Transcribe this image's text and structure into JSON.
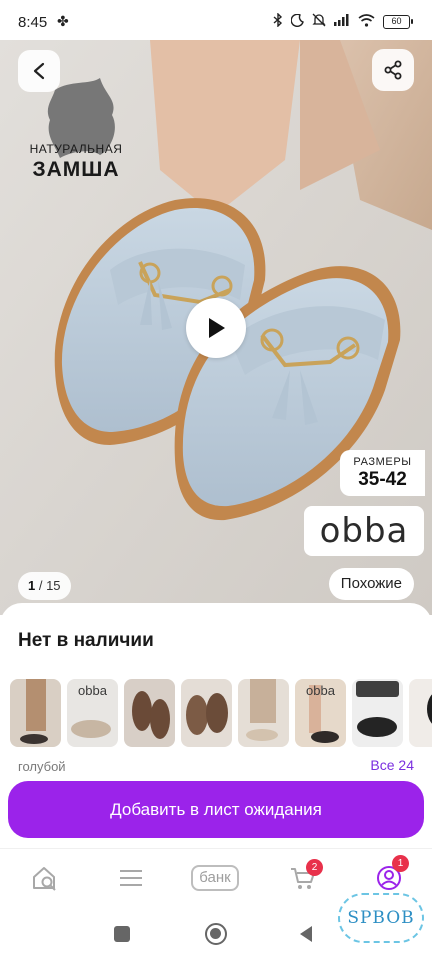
{
  "status_bar": {
    "time": "8:45",
    "battery": "60"
  },
  "hero": {
    "suede_line1": "НАТУРАЛЬНАЯ",
    "suede_line2": "ЗАМША",
    "sizes_title": "РАЗМЕРЫ",
    "sizes_range": "35-42",
    "brand": "obba",
    "counter_current": "1",
    "counter_total": "15",
    "similar_label": "Похожие"
  },
  "availability": "Нет в наличии",
  "variants": {
    "thumb_brand": "obba",
    "color": "голубой",
    "all_label": "Все 24"
  },
  "add_button": "Добавить в лист ожидания",
  "nav": {
    "bank_label": "банк",
    "cart_badge": "2",
    "profile_badge": "1"
  },
  "watermark": "SPBOB",
  "colors": {
    "accent": "#9b23ea",
    "badge": "#e8314b",
    "link": "#7b2fe0"
  }
}
